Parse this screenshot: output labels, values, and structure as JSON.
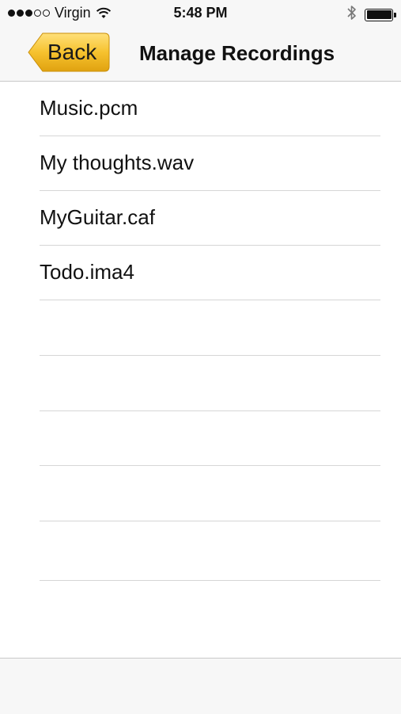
{
  "status_bar": {
    "carrier": "Virgin",
    "time": "5:48 PM",
    "signal_bars_filled": 3,
    "signal_bars_total": 5,
    "battery_level": 1.0,
    "icons": [
      "signal-icon",
      "wifi-icon",
      "bluetooth-icon",
      "battery-icon"
    ]
  },
  "nav": {
    "back_label": "Back",
    "title": "Manage Recordings",
    "back_color": "#f2b81b"
  },
  "recordings": [
    {
      "name": "Music.pcm"
    },
    {
      "name": "My thoughts.wav"
    },
    {
      "name": "MyGuitar.caf"
    },
    {
      "name": "Todo.ima4"
    },
    {
      "name": ""
    },
    {
      "name": ""
    },
    {
      "name": ""
    },
    {
      "name": ""
    },
    {
      "name": ""
    }
  ]
}
